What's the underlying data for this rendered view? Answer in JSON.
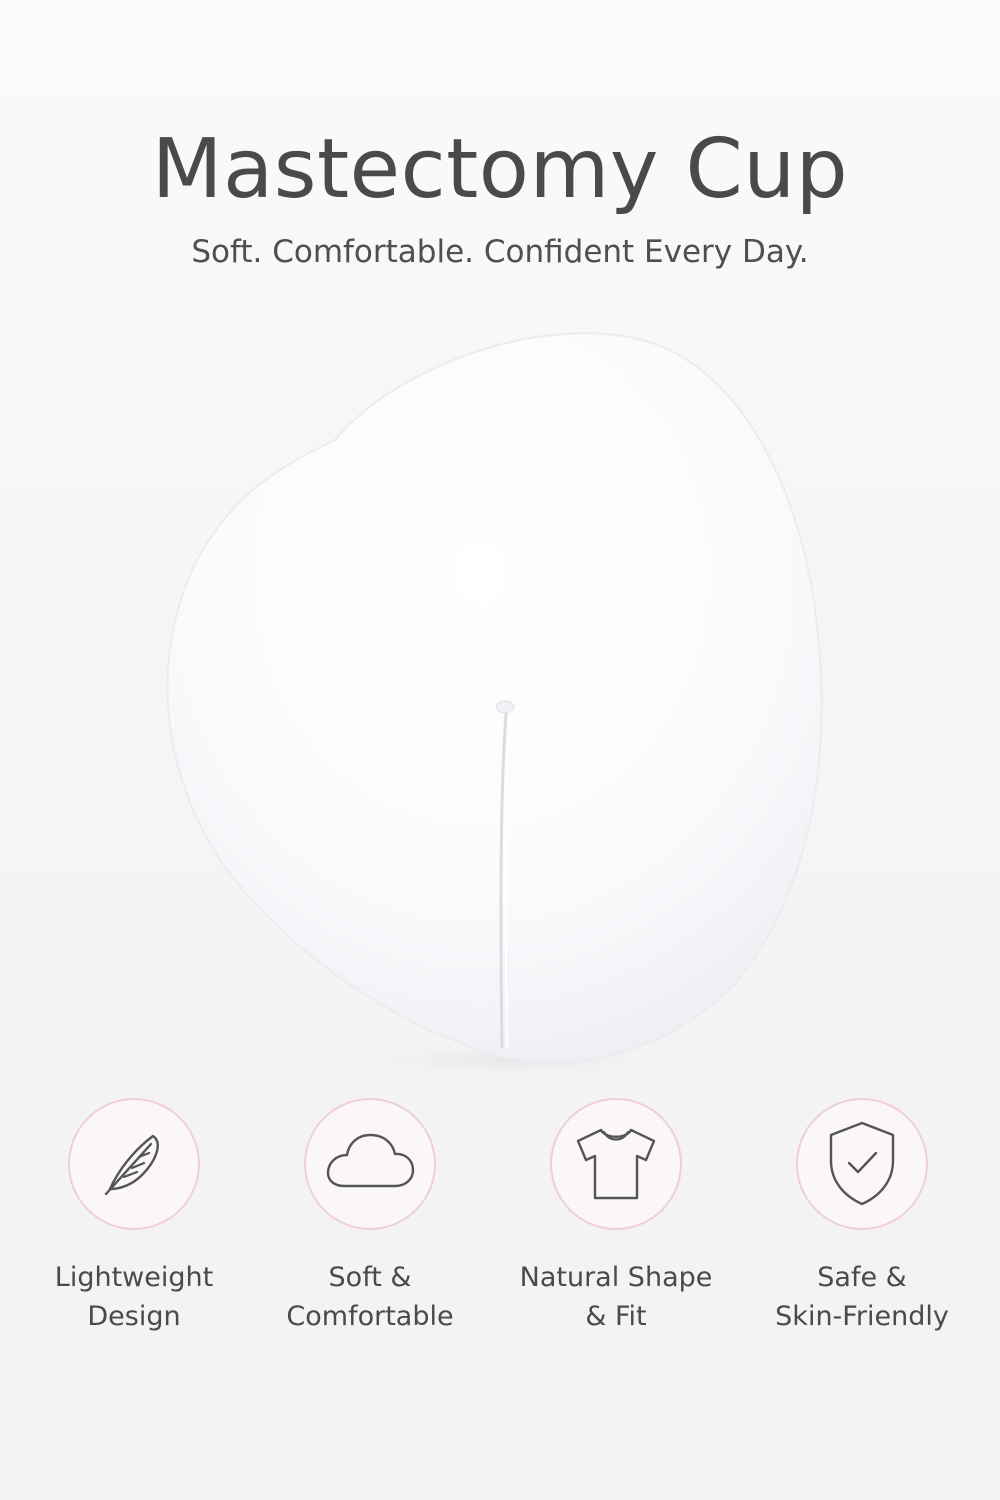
{
  "header": {
    "title": "Mastectomy Cup",
    "subtitle": "Soft. Comfortable. Confident Every Day."
  },
  "features": [
    {
      "icon": "feather-icon",
      "line1": "Lightweight",
      "line2": "Design"
    },
    {
      "icon": "cloud-icon",
      "line1": "Soft &",
      "line2": "Comfortable"
    },
    {
      "icon": "tshirt-icon",
      "line1": "Natural Shape",
      "line2": "& Fit"
    },
    {
      "icon": "shield-check-icon",
      "line1": "Safe &",
      "line2": "Skin-Friendly"
    }
  ],
  "colors": {
    "text": "#4a4a4a",
    "icon_outline": "#efcfd6",
    "icon_stroke": "#555555",
    "product": "#ffffff"
  }
}
